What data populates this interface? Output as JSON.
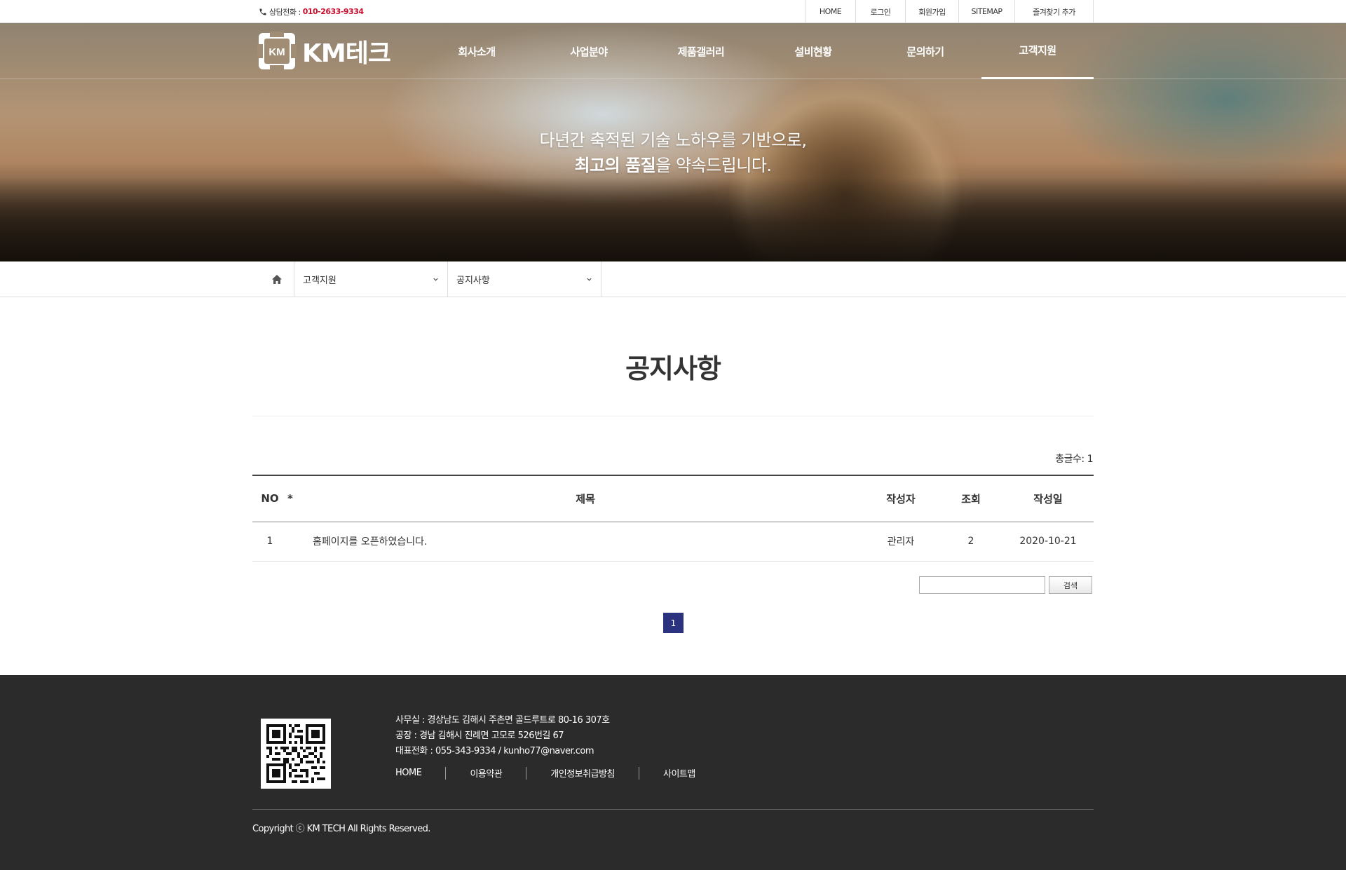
{
  "topbar": {
    "phone_label": "상담전화 :",
    "phone_number": "010-2633-9334",
    "links": [
      "HOME",
      "로그인",
      "회원가입",
      "SITEMAP",
      "즐겨찾기 추가"
    ]
  },
  "header": {
    "logo_mark": "KM",
    "logo_text": "KM테크",
    "menu": [
      "회사소개",
      "사업분야",
      "제품갤러리",
      "설비현황",
      "문의하기",
      "고객지원"
    ],
    "active_menu": "고객지원"
  },
  "hero": {
    "line1": "다년간 축적된 기술 노하우를 기반으로,",
    "line2_bold": "최고의 품질",
    "line2_rest": "을 약속드립니다."
  },
  "breadcrumb": {
    "level1": "고객지원",
    "level2": "공지사항"
  },
  "board": {
    "title": "공지사항",
    "total_label": "총글수: 1",
    "columns": {
      "no": "NO",
      "star": "*",
      "subject": "제목",
      "writer": "작성자",
      "hits": "조회",
      "date": "작성일"
    },
    "rows": [
      {
        "no": "1",
        "subject": "홈페이지를 오픈하였습니다.",
        "writer": "관리자",
        "hits": "2",
        "date": "2020-10-21"
      }
    ],
    "search_button": "검색",
    "search_value": "",
    "current_page": "1"
  },
  "footer": {
    "office": "사무실 : 경상남도 김해시 주촌면 골드루트로 80-16 307호",
    "factory": "공장 : 경남 김해시 진례면 고모로 526번길 67",
    "contact": "대표전화 : 055-343-9334 / kunho77@naver.com",
    "links": [
      "HOME",
      "이용약관",
      "개인정보취급방침",
      "사이트맵"
    ],
    "copyright": "Copyright ⓒ KM TECH All Rights Reserved."
  },
  "colors": {
    "accent_phone": "#c8102e",
    "pagination": "#2b3380",
    "footer_bg": "#2b2b2b"
  }
}
